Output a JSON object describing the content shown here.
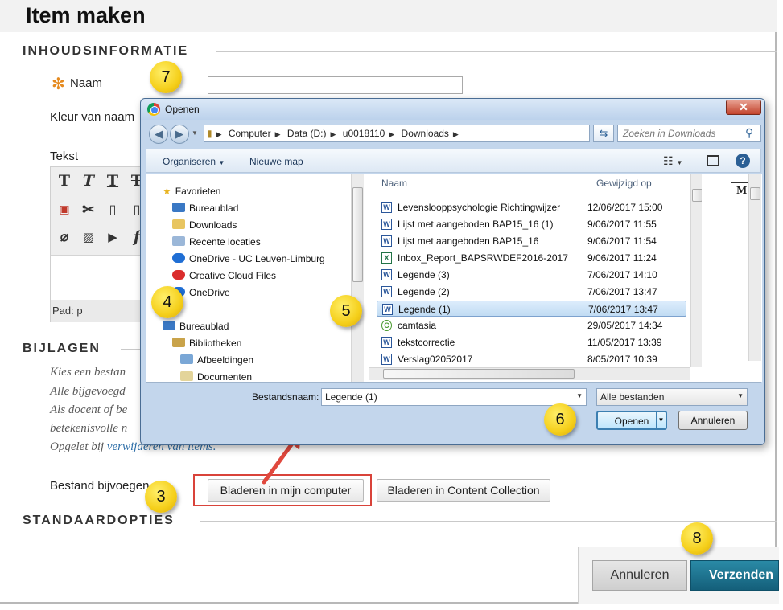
{
  "page": {
    "title": "Item maken",
    "sections": {
      "content_info": "INHOUDSINFORMATIE",
      "attachments": "BIJLAGEN",
      "standard_options": "STANDAARDOPTIES"
    },
    "name_label": "Naam",
    "required_marker": "✻",
    "color_label": "Kleur van naam",
    "text_label": "Tekst",
    "editor_path": "Pad: p",
    "attachment_help": [
      "Kies een bestan",
      "Alle bijgevoegd",
      "Als docent of be",
      "betekenisvolle n",
      "Opgelet bij "
    ],
    "attachment_help_link": "verwijderen van items.",
    "file_label": "Bestand bijvoegen",
    "browse_computer": "Bladeren in mijn computer",
    "browse_collection": "Bladeren in Content Collection",
    "cancel": "Annuleren",
    "submit": "Verzenden"
  },
  "callouts": [
    "7",
    "4",
    "5",
    "3",
    "6",
    "8"
  ],
  "dialog": {
    "title": "Openen",
    "breadcrumb": [
      "Computer",
      "Data (D:)",
      "u0018110",
      "Downloads"
    ],
    "search_placeholder": "Zoeken in Downloads",
    "commands": {
      "organize": "Organiseren",
      "new_folder": "Nieuwe map"
    },
    "nav": [
      {
        "label": "Favorieten",
        "icon": "star-icon"
      },
      {
        "label": "Bureaublad",
        "icon": "desktop-icon"
      },
      {
        "label": "Downloads",
        "icon": "downloads-folder-icon"
      },
      {
        "label": "Recente locaties",
        "icon": "recent-icon"
      },
      {
        "label": "OneDrive - UC Leuven-Limburg",
        "icon": "onedrive-icon"
      },
      {
        "label": "Creative Cloud Files",
        "icon": "creative-cloud-icon"
      },
      {
        "label": "OneDrive",
        "icon": "onedrive-icon"
      },
      {
        "label": "Bureaublad",
        "icon": "desktop-icon"
      },
      {
        "label": "Bibliotheken",
        "icon": "libraries-icon"
      },
      {
        "label": "Afbeeldingen",
        "icon": "pictures-icon"
      },
      {
        "label": "Documenten",
        "icon": "documents-icon"
      }
    ],
    "columns": {
      "name": "Naam",
      "modified": "Gewijzigd op"
    },
    "files": [
      {
        "name": "Levenslooppsychologie Richtingwijzer",
        "date": "12/06/2017 15:00",
        "icon": "W"
      },
      {
        "name": "Lijst met aangeboden BAP15_16 (1)",
        "date": "9/06/2017 11:55",
        "icon": "W"
      },
      {
        "name": "Lijst met aangeboden BAP15_16",
        "date": "9/06/2017 11:54",
        "icon": "W"
      },
      {
        "name": "Inbox_Report_BAPSRWDEF2016-2017",
        "date": "9/06/2017 11:24",
        "icon": "X"
      },
      {
        "name": "Legende (3)",
        "date": "7/06/2017 14:10",
        "icon": "W"
      },
      {
        "name": "Legende (2)",
        "date": "7/06/2017 13:47",
        "icon": "W"
      },
      {
        "name": "Legende (1)",
        "date": "7/06/2017 13:47",
        "icon": "W"
      },
      {
        "name": "camtasia",
        "date": "29/05/2017 14:34",
        "icon": "C"
      },
      {
        "name": "tekstcorrectie",
        "date": "11/05/2017 13:39",
        "icon": "W"
      },
      {
        "name": "Verslag02052017",
        "date": "8/05/2017 10:39",
        "icon": "W"
      }
    ],
    "selected_file_index": 6,
    "preview_text": "M",
    "filename_label": "Bestandsnaam:",
    "filename_value": "Legende (1)",
    "filter_value": "Alle bestanden",
    "open": "Openen",
    "cancel": "Annuleren"
  }
}
